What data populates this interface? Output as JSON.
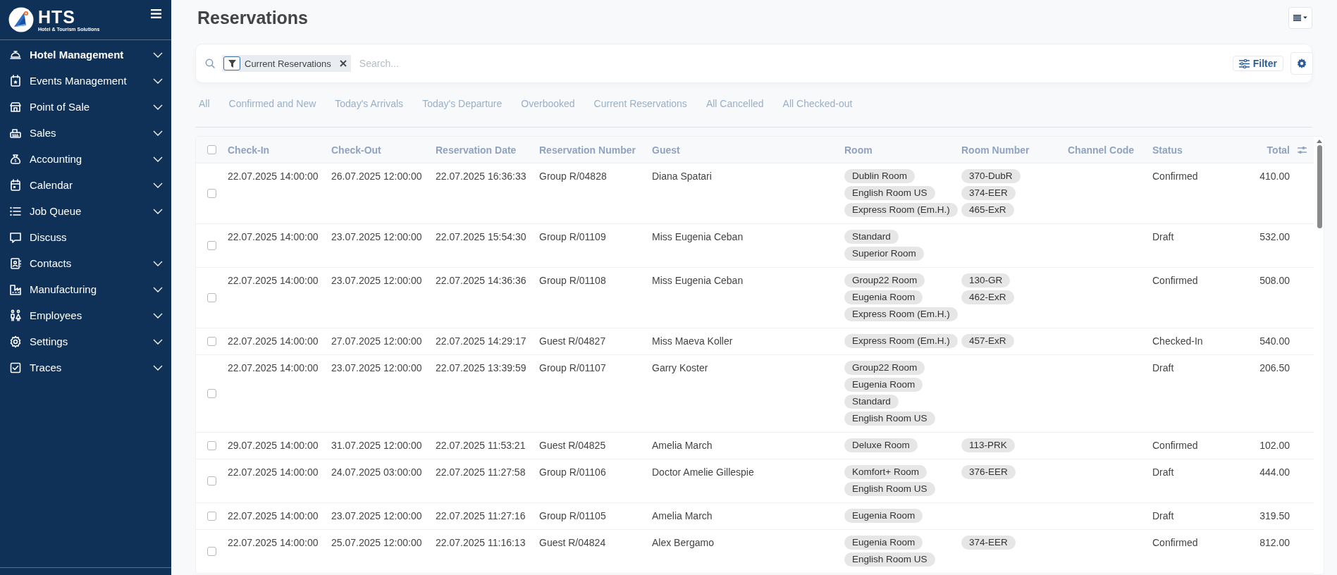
{
  "sidebar": {
    "logo": {
      "name": "HTS",
      "tagline": "Hotel & Tourism Solutions"
    },
    "items": [
      {
        "label": "Hotel Management",
        "selected": true,
        "expandable": true
      },
      {
        "label": "Events Management",
        "selected": false,
        "expandable": true
      },
      {
        "label": "Point of Sale",
        "selected": false,
        "expandable": true
      },
      {
        "label": "Sales",
        "selected": false,
        "expandable": true
      },
      {
        "label": "Accounting",
        "selected": false,
        "expandable": true
      },
      {
        "label": "Calendar",
        "selected": false,
        "expandable": true
      },
      {
        "label": "Job Queue",
        "selected": false,
        "expandable": true
      },
      {
        "label": "Discuss",
        "selected": false,
        "expandable": false
      },
      {
        "label": "Contacts",
        "selected": false,
        "expandable": true
      },
      {
        "label": "Manufacturing",
        "selected": false,
        "expandable": true
      },
      {
        "label": "Employees",
        "selected": false,
        "expandable": true
      },
      {
        "label": "Settings",
        "selected": false,
        "expandable": true
      },
      {
        "label": "Traces",
        "selected": false,
        "expandable": true
      }
    ]
  },
  "page": {
    "title": "Reservations"
  },
  "search": {
    "facet": "Current Reservations",
    "placeholder": "Search...",
    "filter_button": "Filter"
  },
  "filter_tabs": [
    {
      "label": "All",
      "selected": false
    },
    {
      "label": "Confirmed and New",
      "selected": false
    },
    {
      "label": "Today's Arrivals",
      "selected": false
    },
    {
      "label": "Today's Departure",
      "selected": false
    },
    {
      "label": "Overbooked",
      "selected": false
    },
    {
      "label": "Current Reservations",
      "selected": false
    },
    {
      "label": "All Cancelled",
      "selected": false
    },
    {
      "label": "All Checked-out",
      "selected": false
    }
  ],
  "table": {
    "select_all": {
      "checked": false
    },
    "columns": [
      "Check-In",
      "Check-Out",
      "Reservation Date",
      "Reservation Number",
      "Guest",
      "Room",
      "Room Number",
      "Channel Code",
      "Status",
      "Total"
    ],
    "rows": [
      {
        "checked": false,
        "check_in": "22.07.2025 14:00:00",
        "check_out": "26.07.2025 12:00:00",
        "reservation_date": "22.07.2025 16:36:33",
        "reservation_number": "Group R/04828",
        "guest": "Diana Spatari",
        "rooms": [
          "Dublin Room",
          "English Room US",
          "Express Room (Em.H.)"
        ],
        "room_numbers": [
          "370-DubR",
          "374-EER",
          "465-ExR"
        ],
        "status": "Confirmed",
        "total": "410.00"
      },
      {
        "checked": false,
        "check_in": "22.07.2025 14:00:00",
        "check_out": "23.07.2025 12:00:00",
        "reservation_date": "22.07.2025 15:54:30",
        "reservation_number": "Group R/01109",
        "guest": "Miss Eugenia Ceban",
        "rooms": [
          "Standard",
          "Superior Room"
        ],
        "room_numbers": [],
        "status": "Draft",
        "total": "532.00"
      },
      {
        "checked": false,
        "check_in": "22.07.2025 14:00:00",
        "check_out": "23.07.2025 12:00:00",
        "reservation_date": "22.07.2025 14:36:36",
        "reservation_number": "Group R/01108",
        "guest": "Miss Eugenia Ceban",
        "rooms": [
          "Group22 Room",
          "Eugenia Room",
          "Express Room (Em.H.)"
        ],
        "room_numbers": [
          "130-GR",
          "462-ExR"
        ],
        "status": "Confirmed",
        "total": "508.00"
      },
      {
        "checked": false,
        "check_in": "22.07.2025 14:00:00",
        "check_out": "27.07.2025 12:00:00",
        "reservation_date": "22.07.2025 14:29:17",
        "reservation_number": "Guest R/04827",
        "guest": "Miss Maeva Koller",
        "rooms": [
          "Express Room (Em.H.)"
        ],
        "room_numbers": [
          "457-ExR"
        ],
        "status": "Checked-In",
        "total": "540.00"
      },
      {
        "checked": false,
        "check_in": "22.07.2025 14:00:00",
        "check_out": "23.07.2025 12:00:00",
        "reservation_date": "22.07.2025 13:39:59",
        "reservation_number": "Group R/01107",
        "guest": "Garry Koster",
        "rooms": [
          "Group22 Room",
          "Eugenia Room",
          "Standard",
          "English Room US"
        ],
        "room_numbers": [],
        "status": "Draft",
        "total": "206.50"
      },
      {
        "checked": false,
        "check_in": "29.07.2025 14:00:00",
        "check_out": "31.07.2025 12:00:00",
        "reservation_date": "22.07.2025 11:53:21",
        "reservation_number": "Guest R/04825",
        "guest": "Amelia March",
        "rooms": [
          "Deluxe Room"
        ],
        "room_numbers": [
          "113-PRK"
        ],
        "status": "Confirmed",
        "total": "102.00"
      },
      {
        "checked": false,
        "check_in": "22.07.2025 14:00:00",
        "check_out": "24.07.2025 03:00:00",
        "reservation_date": "22.07.2025 11:27:58",
        "reservation_number": "Group R/01106",
        "guest": "Doctor Amelie Gillespie",
        "rooms": [
          "Komfort+ Room",
          "English Room US"
        ],
        "room_numbers": [
          "376-EER"
        ],
        "status": "Draft",
        "total": "444.00"
      },
      {
        "checked": false,
        "check_in": "22.07.2025 14:00:00",
        "check_out": "23.07.2025 12:00:00",
        "reservation_date": "22.07.2025 11:27:16",
        "reservation_number": "Group R/01105",
        "guest": "Amelia March",
        "rooms": [
          "Eugenia Room"
        ],
        "room_numbers": [],
        "status": "Draft",
        "total": "319.50"
      },
      {
        "checked": false,
        "check_in": "22.07.2025 14:00:00",
        "check_out": "25.07.2025 12:00:00",
        "reservation_date": "22.07.2025 11:16:13",
        "reservation_number": "Guest R/04824",
        "guest": "Alex Bergamo",
        "rooms": [
          "Eugenia Room",
          "English Room US"
        ],
        "room_numbers": [
          "374-EER"
        ],
        "status": "Confirmed",
        "total": "812.00"
      }
    ]
  }
}
